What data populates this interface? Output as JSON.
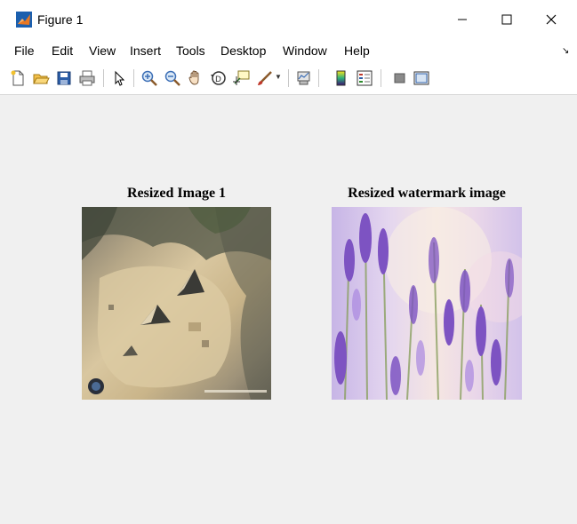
{
  "window": {
    "title": "Figure 1",
    "controls": {
      "minimize": "minimize-icon",
      "maximize": "maximize-icon",
      "close": "close-icon"
    }
  },
  "menu": {
    "items": [
      "File",
      "Edit",
      "View",
      "Insert",
      "Tools",
      "Desktop",
      "Window",
      "Help"
    ]
  },
  "toolbar": {
    "icons": [
      "new-figure-icon",
      "open-file-icon",
      "save-icon",
      "print-icon",
      "pointer-icon",
      "zoom-in-icon",
      "zoom-out-icon",
      "pan-hand-icon",
      "rotate-3d-icon",
      "data-cursor-icon",
      "brush-icon",
      "link-plot-icon",
      "insert-colorbar-icon",
      "insert-legend-icon",
      "hide-plot-tools-icon",
      "show-plot-tools-icon"
    ]
  },
  "figure": {
    "axes": [
      {
        "title": "Resized Image 1",
        "image": "aerial-pyramids-image"
      },
      {
        "title": "Resized watermark image",
        "image": "lavender-flowers-image"
      }
    ]
  },
  "colors": {
    "window_bg": "#f0f0f0",
    "titlebar_bg": "#ffffff",
    "text": "#000000"
  }
}
